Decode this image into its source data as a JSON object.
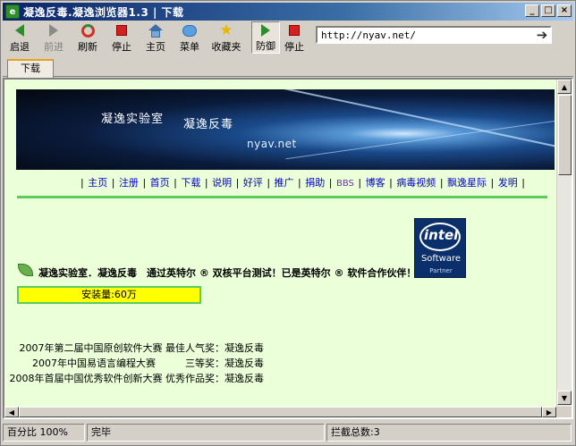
{
  "window": {
    "title": "凝逸反毒.凝逸浏览器1.3 | 下载",
    "app_icon_glyph": "e",
    "buttons": {
      "minimize": "_",
      "maximize": "□",
      "close": "×"
    }
  },
  "toolbar": {
    "items": [
      {
        "id": "back",
        "label": "启退",
        "icon": "back-arrow-icon",
        "enabled": true
      },
      {
        "id": "forward",
        "label": "前进",
        "icon": "forward-arrow-icon",
        "enabled": false
      },
      {
        "id": "refresh",
        "label": "刷新",
        "icon": "refresh-icon",
        "enabled": true
      },
      {
        "id": "stop",
        "label": "停止",
        "icon": "stop-icon",
        "enabled": true
      },
      {
        "id": "home",
        "label": "主页",
        "icon": "home-icon",
        "enabled": true
      },
      {
        "id": "menu",
        "label": "菜单",
        "icon": "chat-bubble-icon",
        "enabled": true
      },
      {
        "id": "favorites",
        "label": "收藏夹",
        "icon": "star-icon",
        "enabled": true
      },
      {
        "id": "defense",
        "label": "防御",
        "icon": "play-icon",
        "enabled": true,
        "active": true
      },
      {
        "id": "stop2",
        "label": "停止",
        "icon": "stop-icon",
        "enabled": true
      }
    ],
    "address": "http://nyav.net/",
    "go_glyph": "➔"
  },
  "tabs": [
    {
      "label": "下载",
      "active": true
    }
  ],
  "page": {
    "banner": {
      "line1": "凝逸实验室",
      "line2": "凝逸反毒",
      "line3": "nyav.net"
    },
    "nav_links": [
      "主页",
      "注册",
      "首页",
      "下载",
      "说明",
      "好评",
      "推广",
      "捐助",
      "BBS",
      "博客",
      "病毒视频",
      "飘逸星际",
      "发明"
    ],
    "nav_separator": "|",
    "intel_badge": {
      "brand": "intel",
      "line1": "Software",
      "line2": "Partner"
    },
    "headline": "凝逸实验室．凝逸反毒　通过英特尔 ® 双核平台测试！已是英特尔 ® 软件合作伙伴！",
    "install_count": "安装量:60万",
    "awards": [
      "2007年第二届中国原创软件大赛  最佳人气奖：凝逸反毒",
      "2007年中国易语言编程大赛　　　三等奖：凝逸反毒",
      "2008年首届中国优秀软件创新大赛  优秀作品奖：凝逸反毒"
    ]
  },
  "statusbar": {
    "zoom": "百分比 100%",
    "status": "完毕",
    "blocked": "拦截总数:3"
  },
  "colors": {
    "page_bg": "#ebffd8",
    "rule": "#5ccc5c",
    "install_bg": "#ffff00",
    "nav_link": "#0000c8",
    "titlebar": "#0a246a"
  }
}
